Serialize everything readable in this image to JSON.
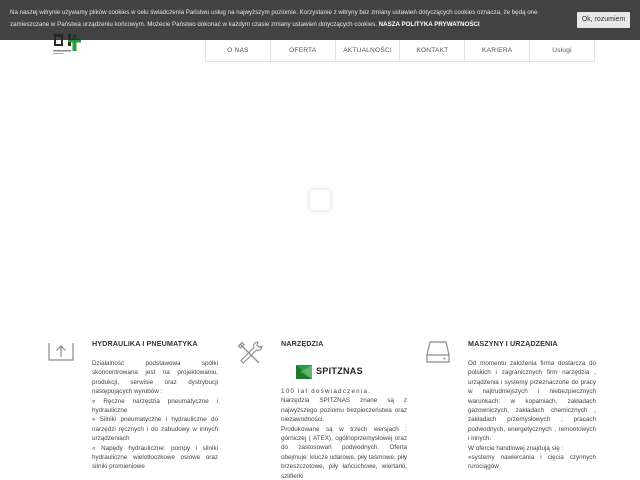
{
  "cookie": {
    "text": "Na naszej witrynie używamy plików cookies w celu świadczenia Państwu usług na najwyższym poziomie. Korzystanie z witryny bez zmiany ustawień dotyczących cookies oznacza, że będą one zamieszczane w Państwa urządzeniu końcowym. Możecie Państwo dokonać w każdym czasie zmiany ustawień dotyczących cookies.",
    "policy_link": "NASZA POLITYKA PRYWATNOŚCI",
    "accept_label": "Ok, rozumiem"
  },
  "nav": {
    "items": [
      "O NAS",
      "OFERTA",
      "AKTUALNOŚCI",
      "KONTAKT",
      "KARIERA",
      "Usługi"
    ]
  },
  "columns": [
    {
      "title": "HYDRAULIKA I PNEUMATYKA",
      "icon": "upload-icon",
      "paragraphs": [
        "Działalność podstawowa spółki skoncentrowana jest na projektowaniu, produkcji, serwisie oraz dystrybucji następujących wyrobów :",
        "« Ręczne narzędzia pneumatyczne i hydrauliczne",
        "« Silniki pneumatyczne i hydrauliczne do narzędzi ręcznych i do zabudowy w innych urządzeniach",
        "« Napędy hydrauliczne: pompy i silniki hydrauliczne wielotłoczkowe osiowe oraz silniki promieniowe"
      ]
    },
    {
      "title": "NARZĘDZIA",
      "icon": "tools-icon",
      "brand": "SPITZNAS",
      "paragraphs": [
        "100 lat doświadczenia.",
        "Narzędzia SPITZNAS znane są z najwyższego poziomu bezpieczeństwa oraz niezawodności.",
        "Produkowane są w trzech wersjach : górniczej ( ATEX), ogólnoprzemysłowej oraz do zastosowań podwodnych. Oferta obejmuje: klucze udarowe, piły taśmowe, piły brzeszczotowe, piły łańcuchowe, wiertarki, szlifierki"
      ]
    },
    {
      "title": "MASZYNY I URZĄDZENIA",
      "icon": "hard-drive-icon",
      "paragraphs": [
        "Od momentu założenia firma dostarcza do polskich i zagranicznych firm narzędzia , urządzenia i systemy przeznaczone do pracy w najtrudniejszych i niebezpiecznych warunkach: w kopalniach, zakładach gazowniczych, zakładach chemicznych , zakładach przemysłowych , pracach podwodnych, energetycznych , remontowych i innych.",
        "W ofercie handlowej znajdują się :",
        "«systemy nawiercania i cięcia czynnych rurociągów"
      ]
    }
  ]
}
